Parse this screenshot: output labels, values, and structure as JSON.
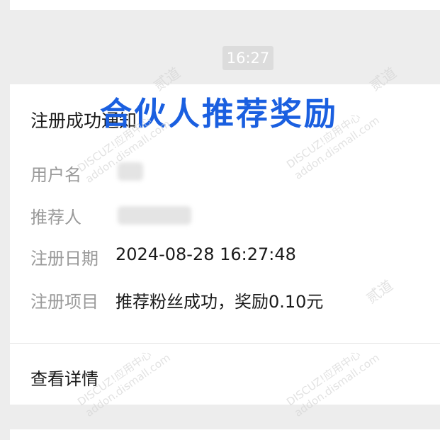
{
  "time": "16:27",
  "message": {
    "title": "注册成功通知",
    "fields": [
      {
        "label": "用户名",
        "value": ""
      },
      {
        "label": "推荐人",
        "value": ""
      },
      {
        "label": "注册日期",
        "value": "2024-08-28 16:27:48"
      },
      {
        "label": "注册项目",
        "value": "推荐粉丝成功，奖励0.10元"
      }
    ],
    "detail_link": "查看详情"
  },
  "overlay": "合伙人推荐奖励",
  "watermark": {
    "brand": "DISCUZ!应用中心",
    "domain": "addon.dismall.com",
    "cn": "贰道"
  },
  "colors": {
    "page_bg": "#ededed",
    "card_bg": "#ffffff",
    "overlay_blue": "#1a5fe0",
    "label_gray": "#9a9a9a"
  }
}
